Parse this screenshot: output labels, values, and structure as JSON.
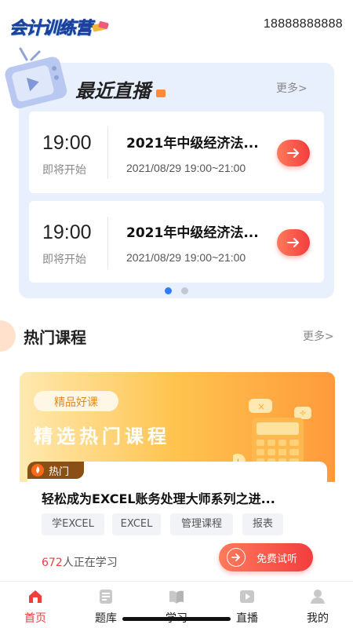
{
  "header": {
    "logo_text": "会计训练营",
    "phone": "18888888888"
  },
  "live": {
    "title": "最近直播",
    "more": "更多>",
    "items": [
      {
        "time": "19:00",
        "status": "即将开始",
        "name": "2021年中级经济法...",
        "date": "2021/08/29 19:00~21:00"
      },
      {
        "time": "19:00",
        "status": "即将开始",
        "name": "2021年中级经济法...",
        "date": "2021/08/29 19:00~21:00"
      }
    ],
    "carousel": {
      "count": 2,
      "active": 0
    }
  },
  "hot": {
    "title": "热门课程",
    "more": "更多>",
    "banner": {
      "pill": "精品好课",
      "title": "精选热门课程"
    },
    "course": {
      "tag": "热门",
      "name": "轻松成为EXCEL账务处理大师系列之进...",
      "tags": [
        "学EXCEL",
        "EXCEL",
        "管理课程",
        "报表"
      ],
      "learner_count": "672",
      "learner_suffix": "人正在学习",
      "trial_label": "免费试听"
    }
  },
  "tabs": [
    {
      "label": "首页",
      "icon": "home-icon",
      "active": true
    },
    {
      "label": "题库",
      "icon": "question-bank-icon",
      "active": false
    },
    {
      "label": "学习",
      "icon": "book-icon",
      "active": false
    },
    {
      "label": "直播",
      "icon": "live-play-icon",
      "active": false
    },
    {
      "label": "我的",
      "icon": "profile-icon",
      "active": false
    }
  ],
  "colors": {
    "accent": "#f23d3d",
    "live_bg": "#e9f0fd",
    "banner_orange": "#ff9a3c",
    "dot_active": "#2f7cf6",
    "dot_inactive": "#c4c8d0"
  }
}
